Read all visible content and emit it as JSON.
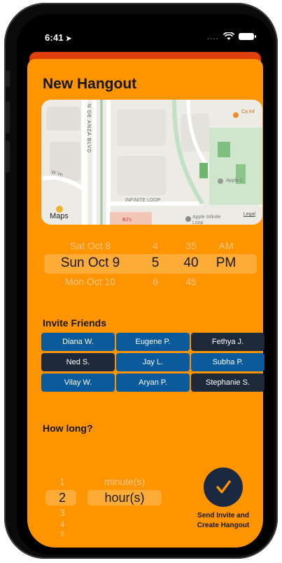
{
  "status": {
    "time": "6:41",
    "signal_dots": "...."
  },
  "sheet": {
    "title": "New Hangout"
  },
  "map": {
    "road": "N DE ANZA BLVD",
    "loop": "INFINITE LOOP",
    "lot": "BJ's",
    "poi_apple": "Apple",
    "poi_apple_loop": "Apple Infinite Loop",
    "poi_apple_right": "Apple C",
    "poi_ca": "Ca Inf",
    "logo": "Maps",
    "legal": "Legal",
    "street_w": "W Ve"
  },
  "picker": {
    "top": {
      "day": "Sat Oct 8",
      "hour": "4",
      "minute": "35",
      "ampm": "AM"
    },
    "mid": {
      "day": "Sun Oct 9",
      "hour": "5",
      "minute": "40",
      "ampm": "PM"
    },
    "bot": {
      "day": "Mon Oct 10",
      "hour": "6",
      "minute": "45"
    }
  },
  "invite": {
    "heading": "Invite Friends",
    "friends": [
      {
        "name": "Diana W."
      },
      {
        "name": "Eugene P."
      },
      {
        "name": "Fethya J."
      },
      {
        "name": "Ned S."
      },
      {
        "name": "Jay L."
      },
      {
        "name": "Subha P."
      },
      {
        "name": "Vilay W."
      },
      {
        "name": "Aryan P."
      },
      {
        "name": "Stephanie S."
      }
    ]
  },
  "duration": {
    "heading": "How long?",
    "numbers": [
      "1",
      "2",
      "3",
      "4",
      "5"
    ],
    "unit_above": "minute(s)",
    "unit_selected": "hour(s)"
  },
  "send": {
    "label_line1": "Send Invite and",
    "label_line2": "Create Hangout"
  },
  "colors": {
    "sheet": "#fe9500",
    "chip_selected": "#0b5a9c",
    "chip_unselected": "#1e2a3a",
    "button": "#1a2940"
  }
}
